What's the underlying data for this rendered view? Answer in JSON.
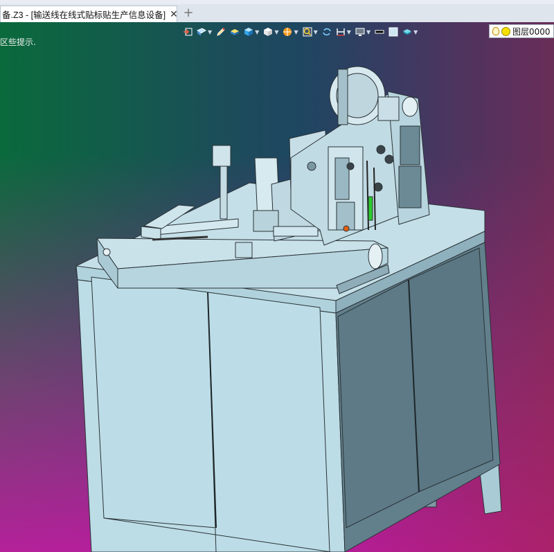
{
  "document_tab": {
    "title": "备.Z3 - [输送线在线式贴标贴生产信息设备]",
    "close_glyph": "✕"
  },
  "new_tab_glyph": "+",
  "prompt_text": "区些提示.",
  "layer": {
    "label": "图层0000"
  },
  "toolbar_icons": [
    "exit-sketch-icon",
    "render-mode-icon",
    "pen-icon",
    "shaded-solid-icon",
    "box-icon",
    "cube-icon",
    "sphere-icon",
    "zoom-icon",
    "rotate-icon",
    "dimension-icon",
    "display-icon",
    "background-color-icon",
    "line-color-icon",
    "layer-stack-icon"
  ]
}
